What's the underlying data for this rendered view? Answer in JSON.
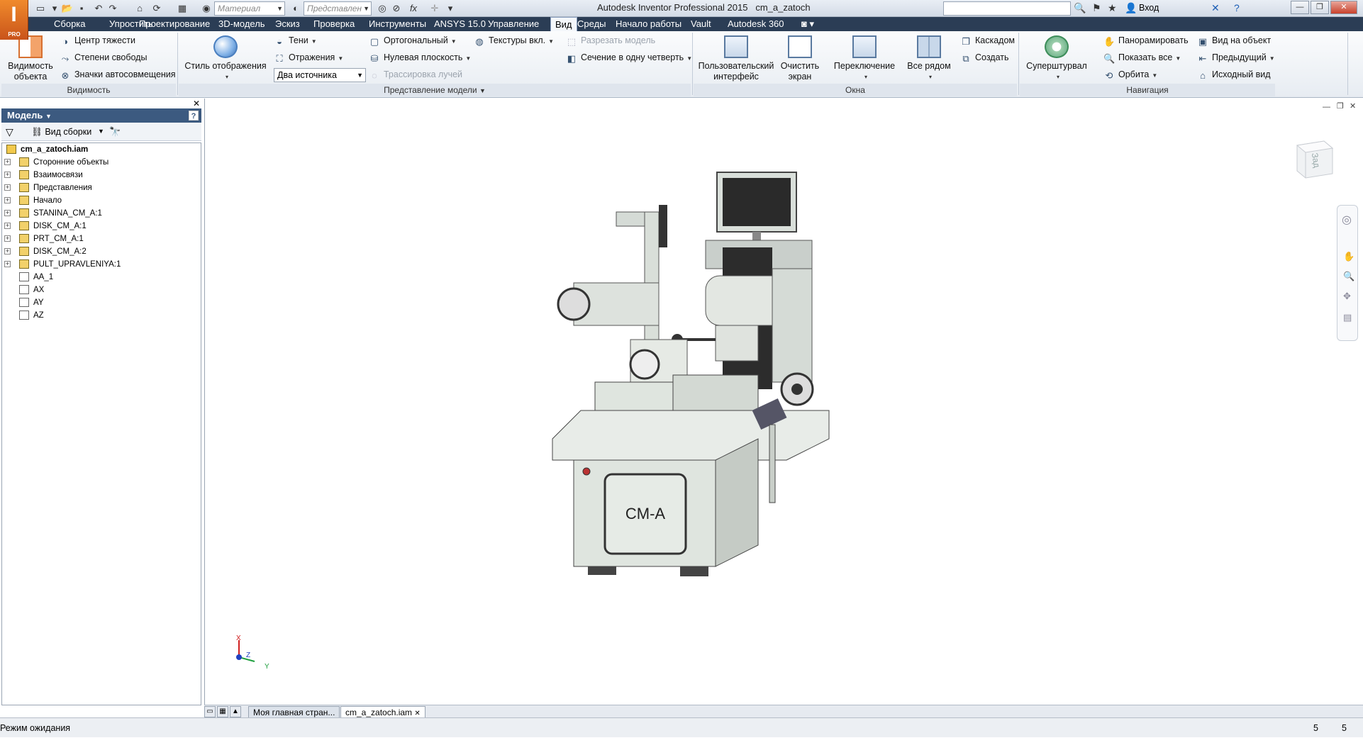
{
  "app": {
    "title": "Autodesk Inventor Professional 2015",
    "document": "cm_a_zatoch",
    "logo_letter": "I",
    "logo_edition": "PRO"
  },
  "quick_access": {
    "material_placeholder": "Материал",
    "appearance_placeholder": "Представлен",
    "formula_icon": "fx"
  },
  "signin": {
    "label": "Вход"
  },
  "menu": {
    "items": [
      "Сборка",
      "Упростить",
      "Проектирование",
      "3D-модель",
      "Эскиз",
      "Проверка",
      "Инструменты",
      "ANSYS 15.0",
      "Управление",
      "Вид",
      "Среды",
      "Начало работы",
      "Vault",
      "Autodesk 360"
    ],
    "active": "Вид"
  },
  "ribbon": {
    "visibility": {
      "title": "Видимость",
      "object_visibility": "Видимость\nобъекта",
      "center_of_gravity": "Центр тяжести",
      "dof": "Степени свободы",
      "auto_constraints": "Значки автосовмещения"
    },
    "appearance": {
      "title": "Представление модели",
      "visual_style": "Стиль отображения",
      "shadows": "Тени",
      "reflections": "Отражения",
      "lighting": "Два источника",
      "orthographic": "Ортогональный",
      "ground_plane": "Нулевая плоскость",
      "ray_tracing": "Трассировка лучей",
      "textures": "Текстуры вкл.",
      "section_model": "Разрезать модель",
      "quarter_section": "Сечение в одну четверть"
    },
    "windows": {
      "title": "Окна",
      "user_interface": "Пользовательский\nинтерфейс",
      "clean_screen": "Очистить\nэкран",
      "switch": "Переключение",
      "tile": "Все рядом",
      "cascade": "Каскадом",
      "new": "Создать"
    },
    "navigation": {
      "title": "Навигация",
      "steering_wheel": "Суперштурвал",
      "pan": "Панорамировать",
      "zoom_all": "Показать все",
      "orbit": "Орбита",
      "look_at": "Вид на объект",
      "previous": "Предыдущий",
      "home_view": "Исходный вид"
    }
  },
  "browser": {
    "header": "Модель",
    "view_label": "Вид сборки",
    "root": "cm_a_zatoch.iam",
    "nodes": [
      "Сторонние объекты",
      "Взаимосвязи",
      "Представления",
      "Начало",
      "STANINA_CM_A:1",
      "DISK_CM_A:1",
      "PRT_CM_A:1",
      "DISK_CM_A:2",
      "PULT_UPRAVLENIYA:1",
      "AA_1",
      "AX",
      "AY",
      "AZ"
    ]
  },
  "viewcube": {
    "face": "Зад"
  },
  "model": {
    "label": "CM-A"
  },
  "triad": {
    "x": "X",
    "y": "Y",
    "z": "Z"
  },
  "tabs": {
    "home": "Моя главная стран...",
    "doc": "cm_a_zatoch.iam"
  },
  "status": {
    "text": "Режим ожидания",
    "count1": "5",
    "count2": "5"
  },
  "colors": {
    "menubar": "#2b3d55",
    "accent": "#3c5a80",
    "machine": "#dfe5df"
  }
}
